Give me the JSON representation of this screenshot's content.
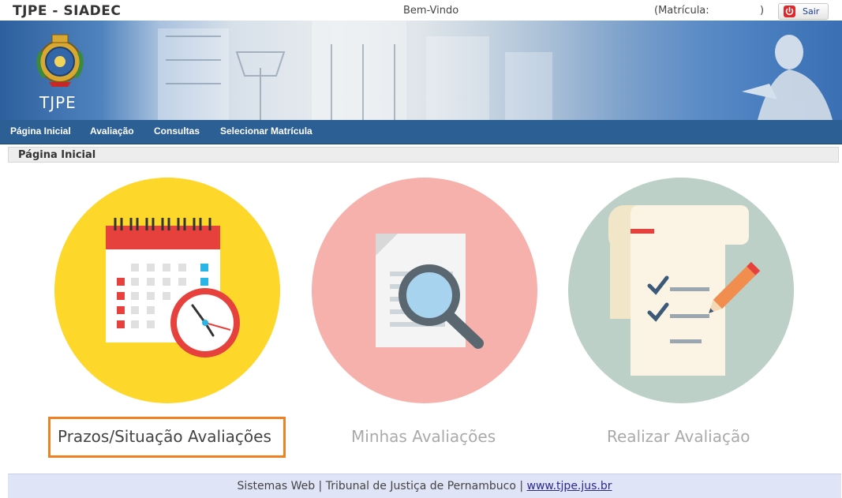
{
  "header": {
    "app_title": "TJPE - SIADEC",
    "welcome": "Bem-Vindo",
    "matricula_label": "(Matrícula:",
    "matricula_close": ")",
    "logout_label": "Sair"
  },
  "banner": {
    "logo_text": "TJPE"
  },
  "nav": {
    "items": [
      "Página Inicial",
      "Avaliação",
      "Consultas",
      "Selecionar Matrícula"
    ]
  },
  "breadcrumb": {
    "current": "Página Inicial"
  },
  "tiles": [
    {
      "label": "Prazos/Situação Avaliações",
      "icon": "calendar-clock-icon",
      "circle_color": "#fdd82a",
      "selected": true
    },
    {
      "label": "Minhas Avaliações",
      "icon": "document-search-icon",
      "circle_color": "#f7b1ac",
      "selected": false
    },
    {
      "label": "Realizar Avaliação",
      "icon": "checklist-pencil-icon",
      "circle_color": "#bcd0c7",
      "selected": false
    }
  ],
  "footer": {
    "text": "Sistemas Web | Tribunal de Justiça de Pernambuco |",
    "link": "www.tjpe.jus.br"
  },
  "colors": {
    "nav_bg": "#2c5f94",
    "highlight": "#f08021",
    "footer_bg": "#dfe4f6"
  }
}
